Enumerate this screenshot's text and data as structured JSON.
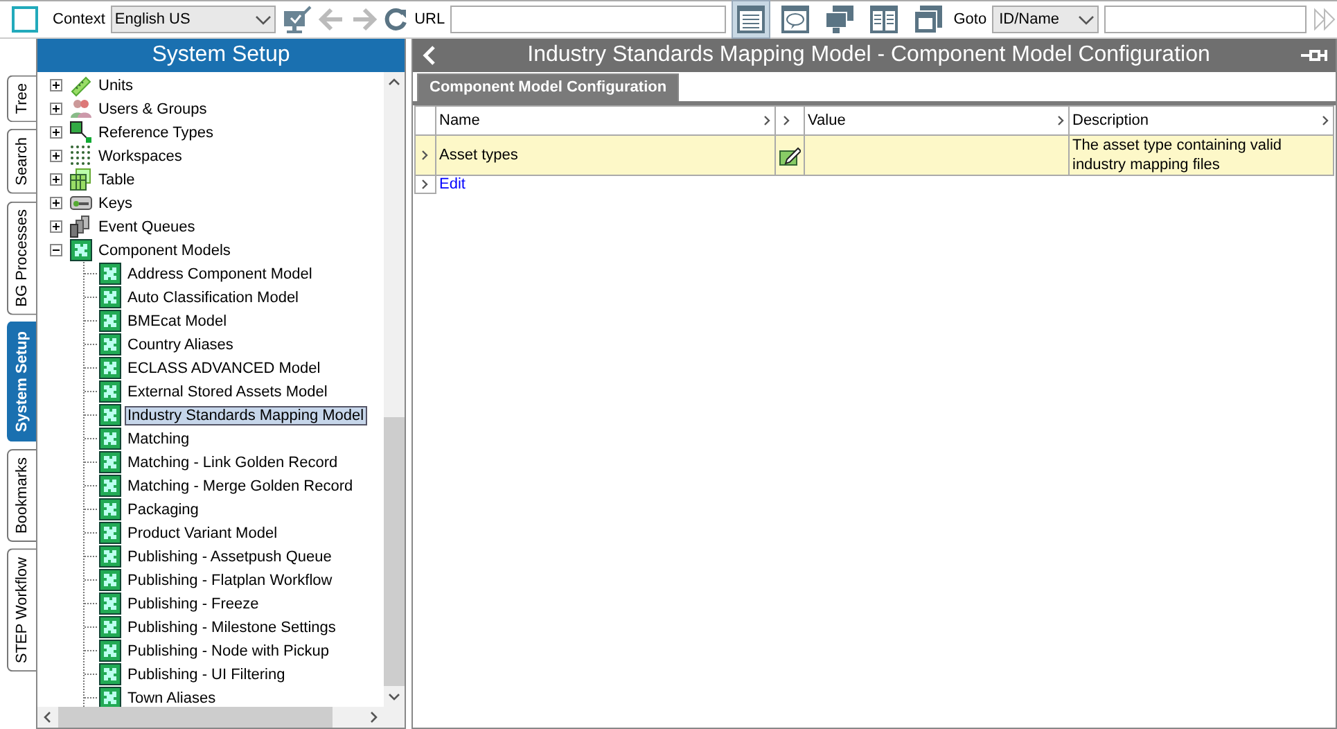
{
  "toolbar": {
    "context_label": "Context",
    "context_value": "English US",
    "url_label": "URL",
    "views": [
      {
        "kind": "list",
        "selected": true
      },
      {
        "kind": "comment",
        "selected": false
      },
      {
        "kind": "screens",
        "selected": false
      },
      {
        "kind": "columns",
        "selected": false
      },
      {
        "kind": "numbered",
        "selected": false
      }
    ],
    "goto_label": "Goto",
    "goto_value": "ID/Name"
  },
  "side_tabs": [
    {
      "label": "Tree",
      "selected": false
    },
    {
      "label": "Search",
      "selected": false
    },
    {
      "label": "BG Processes",
      "selected": false
    },
    {
      "label": "System Setup",
      "selected": true
    },
    {
      "label": "Bookmarks",
      "selected": false
    },
    {
      "label": "STEP Workflow",
      "selected": false
    }
  ],
  "tree": {
    "title": "System Setup",
    "items": [
      {
        "label": "Units",
        "kind": "ruler",
        "expanded": false
      },
      {
        "label": "Users & Groups",
        "kind": "users",
        "expanded": false
      },
      {
        "label": "Reference Types",
        "kind": "reference",
        "expanded": false
      },
      {
        "label": "Workspaces",
        "kind": "grid",
        "expanded": false
      },
      {
        "label": "Table",
        "kind": "table",
        "expanded": false
      },
      {
        "label": "Keys",
        "kind": "keys",
        "expanded": false
      },
      {
        "label": "Event Queues",
        "kind": "queue",
        "expanded": false
      },
      {
        "label": "Component Models",
        "kind": "puzzle",
        "expanded": true,
        "children": [
          {
            "label": "Address Component Model",
            "selected": false
          },
          {
            "label": "Auto Classification Model",
            "selected": false
          },
          {
            "label": "BMEcat Model",
            "selected": false
          },
          {
            "label": "Country Aliases",
            "selected": false
          },
          {
            "label": "ECLASS ADVANCED Model",
            "selected": false
          },
          {
            "label": "External Stored Assets Model",
            "selected": false
          },
          {
            "label": "Industry Standards Mapping Model",
            "selected": true
          },
          {
            "label": "Matching",
            "selected": false
          },
          {
            "label": "Matching - Link Golden Record",
            "selected": false
          },
          {
            "label": "Matching - Merge Golden Record",
            "selected": false
          },
          {
            "label": "Packaging",
            "selected": false
          },
          {
            "label": "Product Variant Model",
            "selected": false
          },
          {
            "label": "Publishing - Assetpush Queue",
            "selected": false
          },
          {
            "label": "Publishing - Flatplan Workflow",
            "selected": false
          },
          {
            "label": "Publishing - Freeze",
            "selected": false
          },
          {
            "label": "Publishing - Milestone Settings",
            "selected": false
          },
          {
            "label": "Publishing - Node with Pickup",
            "selected": false
          },
          {
            "label": "Publishing - UI Filtering",
            "selected": false
          },
          {
            "label": "Town Aliases",
            "selected": false
          }
        ]
      }
    ]
  },
  "panel": {
    "title": "Industry Standards Mapping Model - Component Model Configuration",
    "tabs": [
      {
        "label": "Component Model Configuration",
        "selected": true
      }
    ],
    "columns": [
      "Name",
      "Value",
      "Description"
    ],
    "rows": [
      {
        "name": "Asset types",
        "description": "The asset type containing valid industry mapping files"
      }
    ],
    "edit_link": "Edit"
  }
}
